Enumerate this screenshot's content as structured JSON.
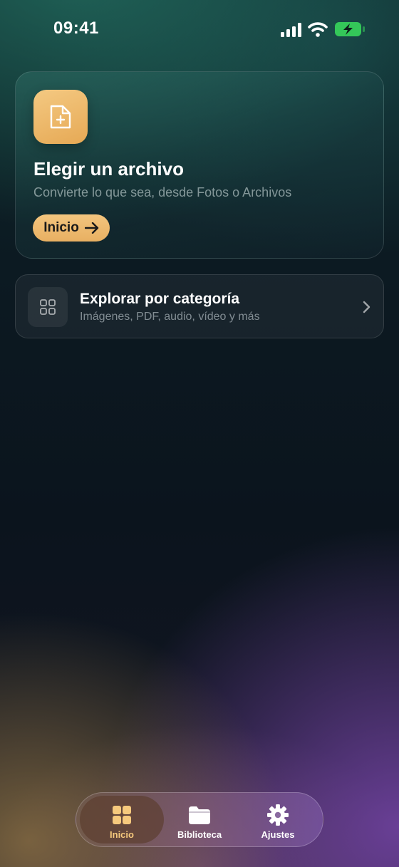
{
  "status_bar": {
    "time": "09:41",
    "icons": [
      "cellular-signal-icon",
      "wifi-icon",
      "battery-charging-icon"
    ],
    "battery_color": "#34c759"
  },
  "upload_card": {
    "icon": "file-plus-icon",
    "title": "Elegir un archivo",
    "subtitle": "Convierte lo que sea, desde Fotos o Archivos",
    "button_label": "Inicio",
    "button_icon": "arrow-right-icon",
    "accent_color": "#f0bd73"
  },
  "category_card": {
    "icon": "grid-icon",
    "title": "Explorar por categoría",
    "subtitle": "Imágenes, PDF, audio, vídeo y más",
    "trailing_icon": "chevron-right-icon"
  },
  "tab_bar": {
    "selected": "Inicio",
    "tabs": [
      {
        "label": "Inicio",
        "icon": "grid-icon"
      },
      {
        "label": "Biblioteca",
        "icon": "folder-icon"
      },
      {
        "label": "Ajustes",
        "icon": "gear-icon"
      }
    ]
  }
}
